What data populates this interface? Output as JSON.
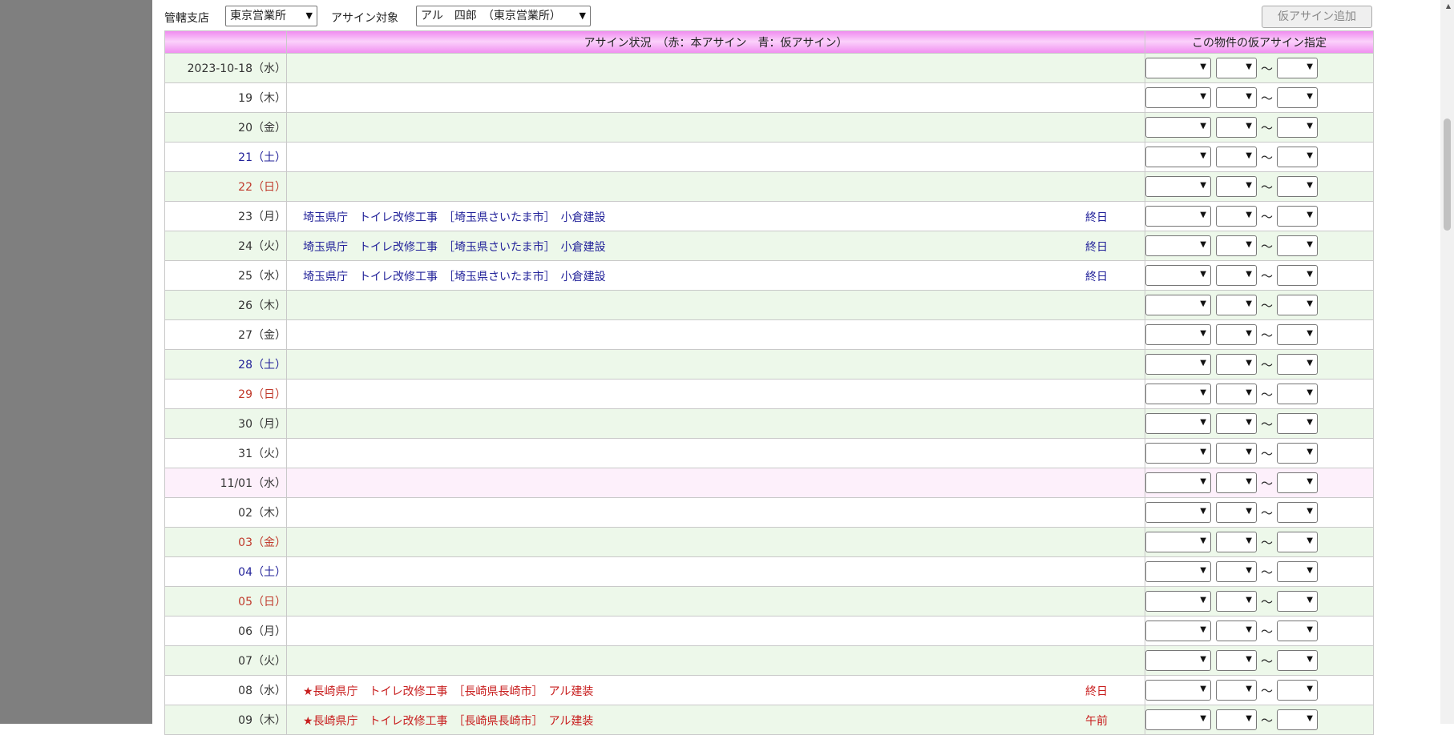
{
  "header": {
    "branch_label": "管轄支店",
    "branch_value": "東京営業所",
    "target_label": "アサイン対象",
    "target_value": "アル　四郎　（東京営業所）",
    "add_button": "仮アサイン追加"
  },
  "table": {
    "col_status": "アサイン状況　（赤：本アサイン　青：仮アサイン）",
    "col_pick": "この物件の仮アサイン指定",
    "tilde": "～",
    "rows": [
      {
        "date": "2023-10-18（水）",
        "day": "normal",
        "bg": "even"
      },
      {
        "date": "19（木）",
        "day": "normal",
        "bg": "odd"
      },
      {
        "date": "20（金）",
        "day": "normal",
        "bg": "even"
      },
      {
        "date": "21（土）",
        "day": "sat",
        "bg": "odd"
      },
      {
        "date": "22（日）",
        "day": "hol",
        "bg": "even"
      },
      {
        "date": "23（月）",
        "day": "normal",
        "bg": "odd",
        "assign": "埼玉県庁　トイレ改修工事　［埼玉県さいたま市］　小倉建設",
        "duration": "終日",
        "color": "blue"
      },
      {
        "date": "24（火）",
        "day": "normal",
        "bg": "even",
        "assign": "埼玉県庁　トイレ改修工事　［埼玉県さいたま市］　小倉建設",
        "duration": "終日",
        "color": "blue"
      },
      {
        "date": "25（水）",
        "day": "normal",
        "bg": "odd",
        "assign": "埼玉県庁　トイレ改修工事　［埼玉県さいたま市］　小倉建設",
        "duration": "終日",
        "color": "blue"
      },
      {
        "date": "26（木）",
        "day": "normal",
        "bg": "even"
      },
      {
        "date": "27（金）",
        "day": "normal",
        "bg": "odd"
      },
      {
        "date": "28（土）",
        "day": "sat",
        "bg": "even"
      },
      {
        "date": "29（日）",
        "day": "hol",
        "bg": "odd"
      },
      {
        "date": "30（月）",
        "day": "normal",
        "bg": "even"
      },
      {
        "date": "31（火）",
        "day": "normal",
        "bg": "odd"
      },
      {
        "date": "11/01（水）",
        "day": "normal",
        "bg": "today"
      },
      {
        "date": "02（木）",
        "day": "normal",
        "bg": "odd"
      },
      {
        "date": "03（金）",
        "day": "hol",
        "bg": "even"
      },
      {
        "date": "04（土）",
        "day": "sat",
        "bg": "odd"
      },
      {
        "date": "05（日）",
        "day": "hol",
        "bg": "even"
      },
      {
        "date": "06（月）",
        "day": "normal",
        "bg": "odd"
      },
      {
        "date": "07（火）",
        "day": "normal",
        "bg": "even"
      },
      {
        "date": "08（水）",
        "day": "normal",
        "bg": "odd",
        "assign": "★長崎県庁　トイレ改修工事　［長崎県長崎市］　アル建装",
        "duration": "終日",
        "color": "red"
      },
      {
        "date": "09（木）",
        "day": "normal",
        "bg": "even",
        "assign": "★長崎県庁　トイレ改修工事　［長崎県長崎市］　アル建装",
        "duration": "午前",
        "color": "red"
      }
    ]
  },
  "icons": {
    "dropdown": "chevron-down-icon",
    "scroll_up": "scroll-up-icon"
  },
  "colors": {
    "header_band": "#f08ef0",
    "row_even": "#edf8ea",
    "row_today": "#fdf0fb",
    "saturday": "#23239a",
    "holiday": "#c0392b",
    "provisional_assign": "#23239a",
    "confirmed_assign": "#c81e1e",
    "gutter": "#7f7f7f"
  }
}
